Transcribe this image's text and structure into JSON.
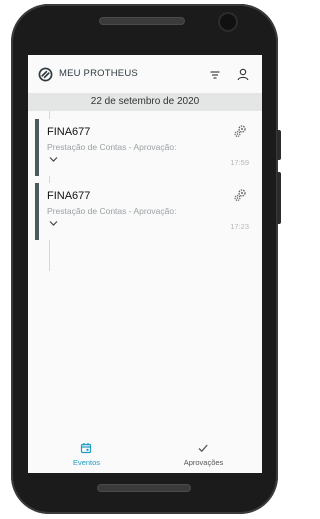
{
  "app": {
    "title": "MEU PROTHEUS",
    "accent_color": "#1e9cc3",
    "logo_icon": "protheus-logo-icon",
    "filter_icon": "filter-icon",
    "profile_icon": "user-icon"
  },
  "date_header": "22 de setembro de 2020",
  "events": [
    {
      "code": "FINA677",
      "description": "Prestação de Contas - Aprovação:",
      "time": "17:59",
      "icon": "gear-icon",
      "expand_icon": "chevron-down-icon",
      "stripe_color": "#4b5a5c"
    },
    {
      "code": "FINA677",
      "description": "Prestação de Contas - Aprovação:",
      "time": "17:23",
      "icon": "gear-icon",
      "expand_icon": "chevron-down-icon",
      "stripe_color": "#4b5a5c"
    }
  ],
  "bottom_nav": {
    "items": [
      {
        "label": "Eventos",
        "icon": "calendar-icon",
        "active": true,
        "color": "#1e9cc3"
      },
      {
        "label": "Aprovações",
        "icon": "check-icon",
        "active": false,
        "color": "#555555"
      }
    ]
  }
}
